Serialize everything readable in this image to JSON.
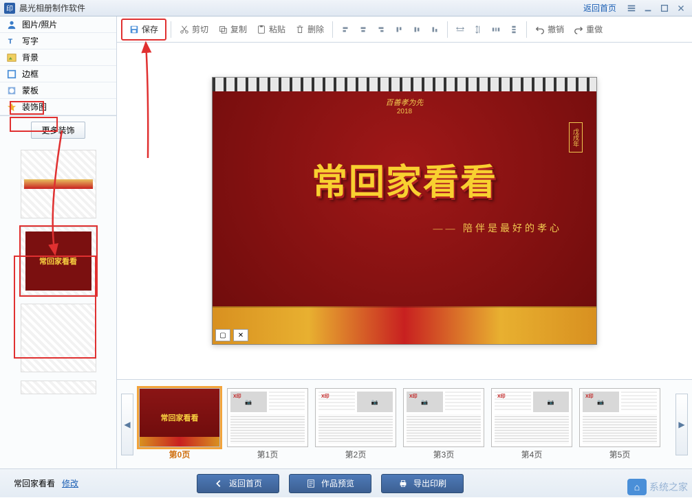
{
  "app": {
    "title": "晨光相册制作软件",
    "icon_text": "印",
    "home_link": "返回首页"
  },
  "sidebar": {
    "items": [
      {
        "label": "图片/照片",
        "icon": "person"
      },
      {
        "label": "写字",
        "icon": "text"
      },
      {
        "label": "背景",
        "icon": "image"
      },
      {
        "label": "边框",
        "icon": "border"
      },
      {
        "label": "蒙板",
        "icon": "mask"
      },
      {
        "label": "装饰图",
        "icon": "star"
      }
    ],
    "more_decoration": "更多装饰"
  },
  "toolbar": {
    "save": "保存",
    "cut": "剪切",
    "copy": "复制",
    "paste": "粘贴",
    "delete": "删除",
    "undo": "撤销",
    "redo": "重做"
  },
  "canvas": {
    "top_text": "百善孝为先",
    "year": "2018",
    "seal": "戊戌年",
    "main_text": "常回家看看",
    "subtitle": "—— 陪伴是最好的孝心"
  },
  "pages": {
    "items": [
      {
        "label": "第0页",
        "active": true
      },
      {
        "label": "第1页",
        "active": false
      },
      {
        "label": "第2页",
        "active": false
      },
      {
        "label": "第3页",
        "active": false
      },
      {
        "label": "第4页",
        "active": false
      },
      {
        "label": "第5页",
        "active": false
      }
    ]
  },
  "bottom": {
    "project_name": "常回家看看",
    "modify": "修改",
    "back_home": "返回首页",
    "preview": "作品预览",
    "export": "导出印刷"
  },
  "watermark": "系统之家"
}
